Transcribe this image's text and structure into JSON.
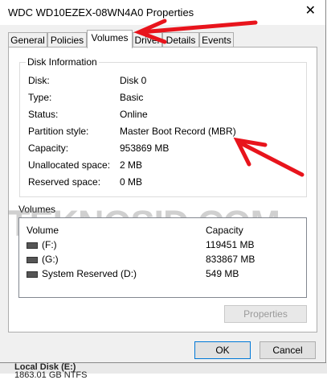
{
  "window": {
    "title": "WDC WD10EZEX-08WN4A0 Properties",
    "close_glyph": "✕"
  },
  "tabs": [
    {
      "label": "General"
    },
    {
      "label": "Policies"
    },
    {
      "label": "Volumes"
    },
    {
      "label": "Driver"
    },
    {
      "label": "Details"
    },
    {
      "label": "Events"
    }
  ],
  "active_tab": "Volumes",
  "disk_info": {
    "group_label": "Disk Information",
    "rows": [
      {
        "label": "Disk:",
        "value": "Disk 0"
      },
      {
        "label": "Type:",
        "value": "Basic"
      },
      {
        "label": "Status:",
        "value": "Online"
      },
      {
        "label": "Partition style:",
        "value": "Master Boot Record (MBR)"
      },
      {
        "label": "Capacity:",
        "value": "953869 MB"
      },
      {
        "label": "Unallocated space:",
        "value": "2 MB"
      },
      {
        "label": "Reserved space:",
        "value": "0 MB"
      }
    ]
  },
  "volumes": {
    "group_label": "Volumes",
    "columns": [
      "Volume",
      "Capacity"
    ],
    "rows": [
      {
        "name": "(F:)",
        "capacity": "119451 MB"
      },
      {
        "name": "(G:)",
        "capacity": "833867 MB"
      },
      {
        "name": "System Reserved (D:)",
        "capacity": "549 MB"
      }
    ],
    "properties_button": "Properties"
  },
  "buttons": {
    "ok": "OK",
    "cancel": "Cancel"
  },
  "watermark": "TEKNOSID.COM",
  "background": {
    "lines": [
      "Local Disk (E:)",
      "1863.01 GB NTFS"
    ]
  },
  "annotation_color": "#e8141c"
}
